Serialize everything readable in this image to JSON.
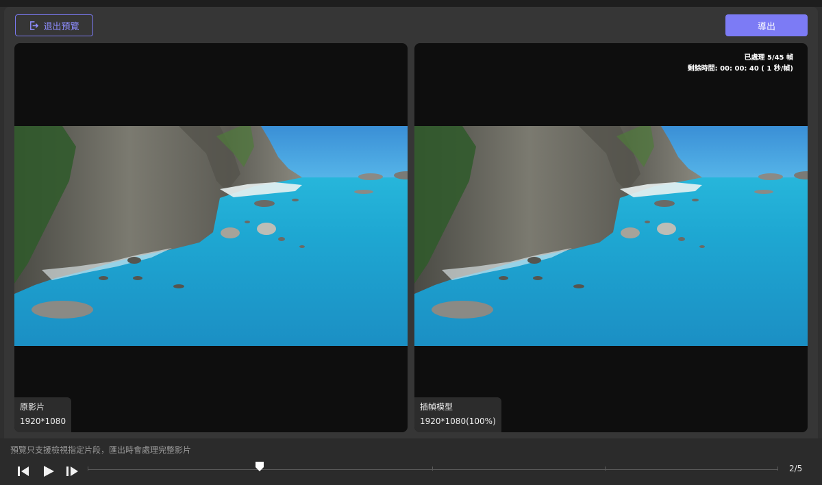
{
  "header": {
    "exit_label": "退出預覽",
    "export_label": "導出"
  },
  "left_pane": {
    "name": "原影片",
    "resolution": "1920*1080"
  },
  "right_pane": {
    "name": "插幀模型",
    "resolution": "1920*1080(100%)",
    "status_processed": "已處理 5/45 幀",
    "status_remaining": "剩餘時間: 00: 00: 40 ( 1 秒/幀)"
  },
  "footer": {
    "hint": "預覽只支援檢視指定片段，匯出時會處理完整影片",
    "pager": "2/5"
  },
  "colors": {
    "accent": "#7c7bf5",
    "sea": "#2aa8d4",
    "sky": "#3f98d8"
  },
  "icons": [
    "exit-icon",
    "step-back-icon",
    "play-icon",
    "step-forward-icon",
    "scrubber-thumb"
  ]
}
